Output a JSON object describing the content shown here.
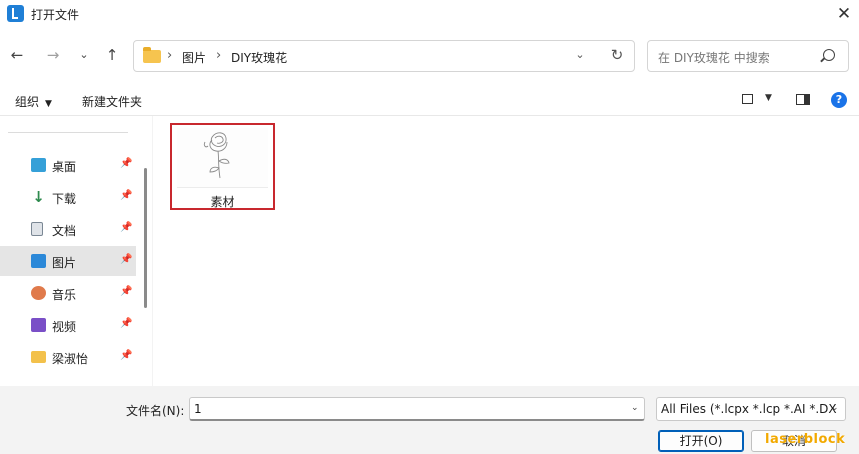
{
  "window": {
    "title": "打开文件",
    "close": "✕"
  },
  "nav": {
    "back": "←",
    "forward": "→",
    "recent": "⌄",
    "up": "↑",
    "sep": "›",
    "breadcrumb": [
      "图片",
      "DIY玫瑰花"
    ],
    "dropdown": "⌄",
    "refresh": "↻"
  },
  "search": {
    "placeholder": "在 DIY玫瑰花 中搜索"
  },
  "toolbar": {
    "organize": "组织",
    "organize_arrow": "▼",
    "new_folder": "新建文件夹",
    "view_arrow": "▼",
    "help": "?"
  },
  "sidebar": {
    "items": [
      {
        "label": "桌面",
        "icon": "desktop-icon",
        "color": "#35a0d8"
      },
      {
        "label": "下载",
        "icon": "download-icon",
        "color": "#2e8a4e"
      },
      {
        "label": "文档",
        "icon": "document-icon",
        "color": "#7a8794"
      },
      {
        "label": "图片",
        "icon": "pictures-icon",
        "color": "#2b88d8",
        "selected": true
      },
      {
        "label": "音乐",
        "icon": "music-icon",
        "color": "#e07a4b"
      },
      {
        "label": "视频",
        "icon": "video-icon",
        "color": "#7a4fc7"
      },
      {
        "label": "梁淑怡",
        "icon": "user-folder-icon",
        "color": "#f3c14b"
      }
    ],
    "pin": "📌"
  },
  "files": [
    {
      "name": "素材"
    }
  ],
  "bottom": {
    "filename_label": "文件名(N):",
    "filename_value": "1",
    "filter": "All Files (*.lcpx *.lcp *.AI *.DX",
    "open": "打开(O)",
    "cancel": "取消",
    "arrow": "⌄"
  },
  "watermark": "laserblock"
}
